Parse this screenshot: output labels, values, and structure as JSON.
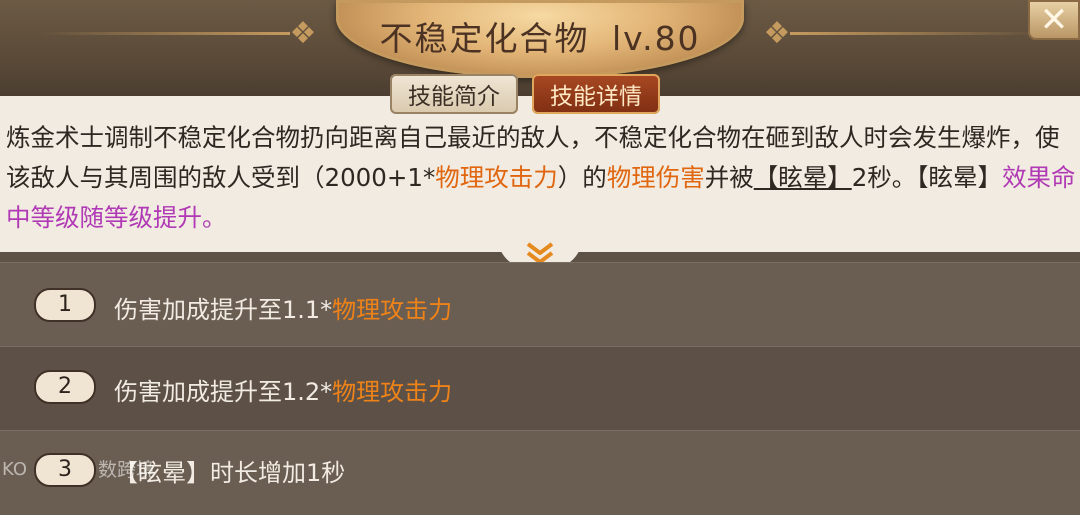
{
  "skill": {
    "name": "不稳定化合物",
    "level": "lv.80"
  },
  "tabs": [
    {
      "label": "技能简介",
      "active": false
    },
    {
      "label": "技能详情",
      "active": true
    }
  ],
  "description": {
    "p1": "炼金术士调制不稳定化合物扔向距离自己最近的敌人，不稳定化合物在砸到敌人时会发生爆炸，使该敌人与其周围的敌人受到（2000+1*",
    "p2_orange": "物理攻击力",
    "p3": "）的",
    "p4_orange": "物理伤害",
    "p5": "并被",
    "p6_bracket": "【眩晕】",
    "p7": "2秒。【眩晕】",
    "p8_purple": "效果命中等级随等级提升。"
  },
  "upgrades": [
    {
      "num": "1",
      "text": "伤害加成提升至1.1*",
      "highlight": "物理攻击力"
    },
    {
      "num": "2",
      "text": "伤害加成提升至1.2*",
      "highlight": "物理攻击力"
    },
    {
      "num": "3",
      "text": "【眩晕】时长增加1秒",
      "highlight": ""
    }
  ],
  "watermark": "数跨境",
  "colors": {
    "orange": "#e0660f",
    "purple": "#b03ab5",
    "active_tab": "#a94923"
  },
  "icons": {
    "close": "close-icon",
    "expand": "chevron-down-double-icon"
  }
}
